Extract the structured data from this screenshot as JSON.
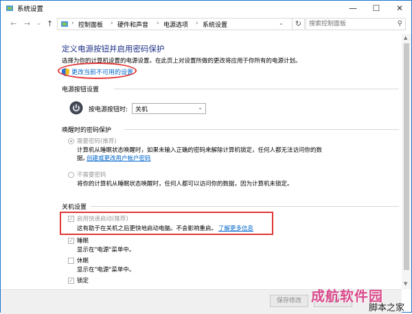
{
  "window": {
    "title": "系统设置",
    "minimize": "—",
    "maximize": "☐",
    "close": "✕"
  },
  "nav": {
    "back": "←",
    "forward": "→",
    "dropdown": "⌄",
    "up": "↑"
  },
  "breadcrumb": [
    "控制面板",
    "硬件和声音",
    "电源选项",
    "系统设置"
  ],
  "breadcrumb_sep": "›",
  "breadcrumb_dropdown": "⌄",
  "refresh": "↻",
  "search": {
    "placeholder": "搜索控制面板",
    "icon": "⚲"
  },
  "page": {
    "heading": "定义电源按钮并启用密码保护",
    "description": "选择为你的计算机设置的电源设置。在此页上对设置所做的更改将应用于你所有的电源计划。",
    "change_link": "更改当前不可用的设置"
  },
  "power_button": {
    "section_title": "电源按钮设置",
    "label": "按电源按钮时:",
    "value": "关机",
    "chevron": "⌄"
  },
  "wake_password": {
    "section_title": "唤醒时的密码保护",
    "options": [
      {
        "label": "需要密码(推荐)",
        "selected": true,
        "desc": "计算机从睡眠状态唤醒时，如果未输入正确的密码来解除计算机锁定，任何人都无法访问你的数",
        "desc2": "据。",
        "link": "创建或更改用户帐户密码"
      },
      {
        "label": "不需要密码",
        "selected": false,
        "desc": "将你的计算机从睡眠状态唤醒时，任何人都可以访问你的数据，因为计算机未锁定。"
      }
    ]
  },
  "shutdown": {
    "section_title": "关机设置",
    "fast_startup": {
      "label": "启用快速启动(推荐)",
      "checked": true,
      "desc": "这有助于在关机之后更快地启动电脑。不会影响重启。",
      "link": "了解更多信息"
    },
    "sleep": {
      "label": "睡眠",
      "checked": true,
      "desc": "显示在\"电源\"菜单中。"
    },
    "hibernate": {
      "label": "休眠",
      "checked": false,
      "desc": "显示在\"电源\"菜单中。"
    },
    "lock": {
      "label": "锁定",
      "checked": true
    }
  },
  "footer": {
    "save": "保存修改",
    "cancel": "取消"
  },
  "scrollbar": {
    "up": "▲",
    "down": "▼"
  },
  "watermark": {
    "main": "成航软件园",
    "sub": "脚本之家"
  },
  "colors": {
    "heading": "#1e3287",
    "link": "#0066cc",
    "highlight": "#e03333",
    "watermark": "#d94b8c"
  }
}
